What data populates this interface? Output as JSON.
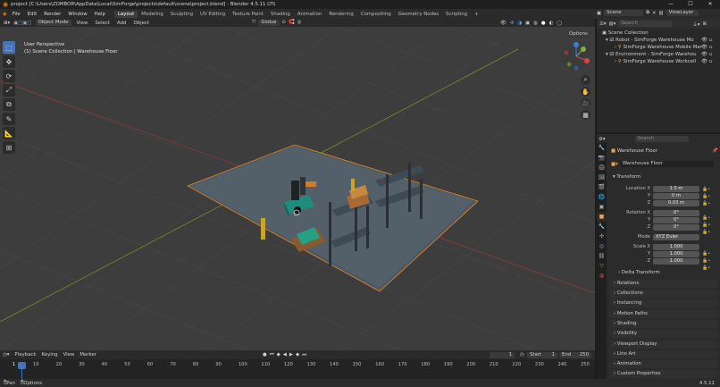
{
  "window": {
    "title": "project [C:\\Users\\ZOMBOR\\AppData\\Local\\SimForge\\projects\\default\\scene\\project.blend] - Blender 4.5.11 LTS",
    "controls": [
      "—",
      "☐",
      "✕"
    ]
  },
  "menus": [
    "File",
    "Edit",
    "Render",
    "Window",
    "Help"
  ],
  "workspaces": [
    "Layout",
    "Modeling",
    "Sculpting",
    "UV Editing",
    "Texture Paint",
    "Shading",
    "Animation",
    "Rendering",
    "Compositing",
    "Geometry Nodes",
    "Scripting",
    "+"
  ],
  "scene_selector": {
    "scene": "Scene",
    "view_layer": "ViewLayer"
  },
  "viewport_header": {
    "mode": "Object Mode",
    "menus": [
      "View",
      "Select",
      "Add",
      "Object"
    ],
    "orientation": "Global",
    "options": "Options"
  },
  "viewport_info": {
    "line1": "User Perspective",
    "line2": "(1) Scene Collection | Warehouse Floor"
  },
  "tools": [
    "⬚",
    "✥",
    "⟳",
    "⤢",
    "⧉",
    "✎",
    "📐",
    "⊞"
  ],
  "outliner": {
    "search_placeholder": "Search",
    "rows": [
      {
        "label": "Scene Collection"
      },
      {
        "label": "Robot - SimForge Warehouse Mo"
      },
      {
        "label": "SimForge Warehouse Mobile Mar"
      },
      {
        "label": "Environment - SimForge Warehou"
      },
      {
        "label": "SimForge Warehouse Workcell"
      }
    ]
  },
  "properties": {
    "search_placeholder": "Search",
    "object_name": "Warehouse Floor",
    "data_name": "Warehouse Floor",
    "transform_label": "Transform",
    "location": {
      "label": "Location X",
      "x": "1.5 m",
      "y": "0 m",
      "z": "0.03 m"
    },
    "rotation": {
      "label": "Rotation X",
      "x": "0°",
      "y": "0°",
      "z": "0°"
    },
    "mode": {
      "label": "Mode",
      "value": "XYZ Euler"
    },
    "scale": {
      "label": "Scale X",
      "x": "1.000",
      "y": "1.000",
      "z": "1.000"
    },
    "axis_y": "Y",
    "axis_z": "Z",
    "delta": "Delta Transform",
    "panels": [
      "Relations",
      "Collections",
      "Instancing",
      "Motion Paths",
      "Shading",
      "Visibility",
      "Viewport Display",
      "Line Art",
      "Animation",
      "Custom Properties"
    ]
  },
  "timeline": {
    "menus": [
      "Playback",
      "Keying",
      "View",
      "Marker"
    ],
    "current": "1",
    "start_label": "Start",
    "start": "1",
    "end_label": "End",
    "end": "250",
    "frames": [
      "1",
      "10",
      "20",
      "30",
      "40",
      "50",
      "60",
      "70",
      "80",
      "90",
      "100",
      "110",
      "120",
      "130",
      "140",
      "150",
      "160",
      "170",
      "180",
      "190",
      "200",
      "210",
      "220",
      "230",
      "240",
      "250"
    ]
  },
  "status": {
    "left": "Pan",
    "left2": "Options",
    "version": "4.5.11"
  }
}
